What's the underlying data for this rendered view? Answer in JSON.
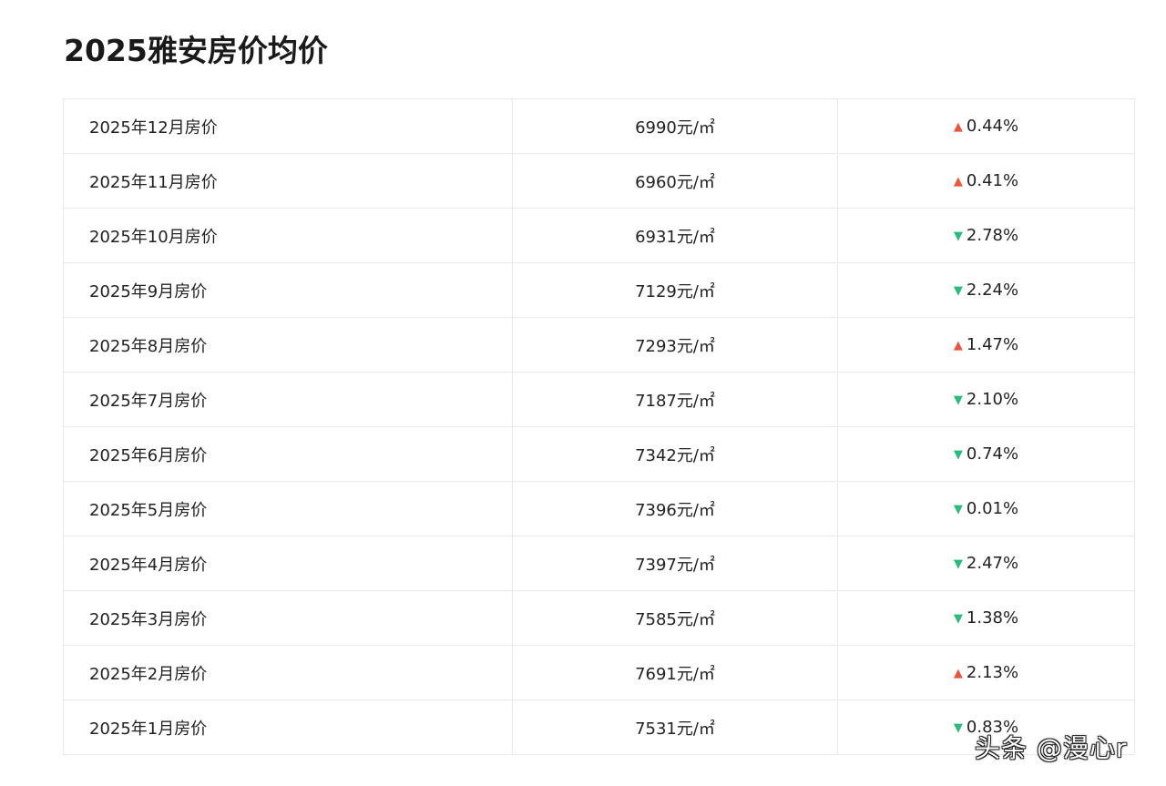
{
  "title": "2025雅安房价均价",
  "colors": {
    "up": "#f0523a",
    "down": "#27bb7c",
    "border": "#e9e9e9"
  },
  "rows": [
    {
      "month": "2025年12月房价",
      "price": "6990元/㎡",
      "direction": "up",
      "change": "0.44%"
    },
    {
      "month": "2025年11月房价",
      "price": "6960元/㎡",
      "direction": "up",
      "change": "0.41%"
    },
    {
      "month": "2025年10月房价",
      "price": "6931元/㎡",
      "direction": "down",
      "change": "2.78%"
    },
    {
      "month": "2025年9月房价",
      "price": "7129元/㎡",
      "direction": "down",
      "change": "2.24%"
    },
    {
      "month": "2025年8月房价",
      "price": "7293元/㎡",
      "direction": "up",
      "change": "1.47%"
    },
    {
      "month": "2025年7月房价",
      "price": "7187元/㎡",
      "direction": "down",
      "change": "2.10%"
    },
    {
      "month": "2025年6月房价",
      "price": "7342元/㎡",
      "direction": "down",
      "change": "0.74%"
    },
    {
      "month": "2025年5月房价",
      "price": "7396元/㎡",
      "direction": "down",
      "change": "0.01%"
    },
    {
      "month": "2025年4月房价",
      "price": "7397元/㎡",
      "direction": "down",
      "change": "2.47%"
    },
    {
      "month": "2025年3月房价",
      "price": "7585元/㎡",
      "direction": "down",
      "change": "1.38%"
    },
    {
      "month": "2025年2月房价",
      "price": "7691元/㎡",
      "direction": "up",
      "change": "2.13%"
    },
    {
      "month": "2025年1月房价",
      "price": "7531元/㎡",
      "direction": "down",
      "change": "0.83%"
    }
  ],
  "watermark": "头条 @漫心r"
}
